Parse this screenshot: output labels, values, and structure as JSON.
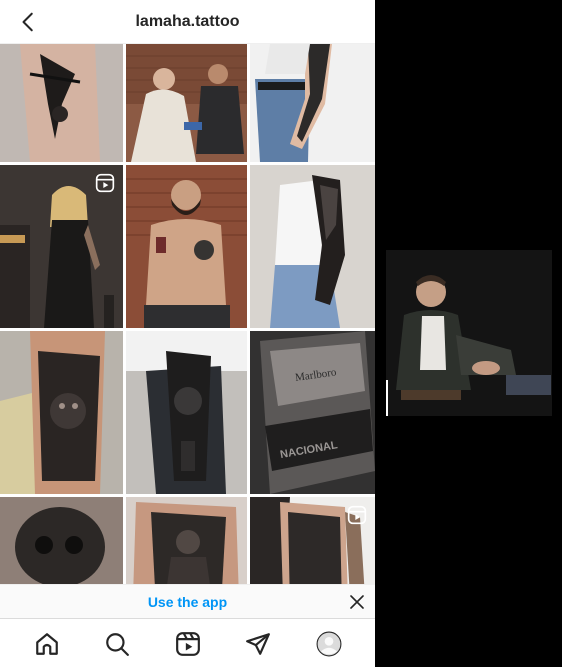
{
  "header": {
    "title": "lamaha.tattoo",
    "back_icon": "chevron-left-icon"
  },
  "grid": {
    "posts": [
      {
        "id": "post-1",
        "kind": "photo",
        "subject": "forearm blackwork tattoo"
      },
      {
        "id": "post-2",
        "kind": "photo",
        "subject": "tattoo session in studio"
      },
      {
        "id": "post-3",
        "kind": "photo",
        "subject": "full sleeve on arm"
      },
      {
        "id": "post-4",
        "kind": "reel",
        "subject": "woman in black dress with sleeve"
      },
      {
        "id": "post-5",
        "kind": "photo",
        "subject": "tattooed man against brick wall"
      },
      {
        "id": "post-6",
        "kind": "photo",
        "subject": "woman with black sleeve tattoo"
      },
      {
        "id": "post-7",
        "kind": "photo",
        "subject": "realistic lion forearm tattoo"
      },
      {
        "id": "post-8",
        "kind": "photo",
        "subject": "realistic portrait forearm tattoo"
      },
      {
        "id": "post-9",
        "kind": "photo",
        "subject": "marlboro pack realism tattoo"
      },
      {
        "id": "post-10",
        "kind": "photo",
        "subject": "realistic skull tattoo"
      },
      {
        "id": "post-11",
        "kind": "photo",
        "subject": "realistic figure tattoo"
      },
      {
        "id": "post-12",
        "kind": "reel",
        "subject": "shoulder sleeve tattoo"
      }
    ]
  },
  "banner": {
    "label": "Use the app"
  },
  "navbar": {
    "items": [
      {
        "name": "home",
        "icon": "home-icon"
      },
      {
        "name": "explore",
        "icon": "search-icon"
      },
      {
        "name": "reels",
        "icon": "reels-icon"
      },
      {
        "name": "direct",
        "icon": "send-icon"
      },
      {
        "name": "profile",
        "icon": "avatar-icon"
      }
    ]
  },
  "colors": {
    "accent": "#0095f6",
    "text": "#262626",
    "background": "#ffffff",
    "backdrop": "#000000"
  }
}
